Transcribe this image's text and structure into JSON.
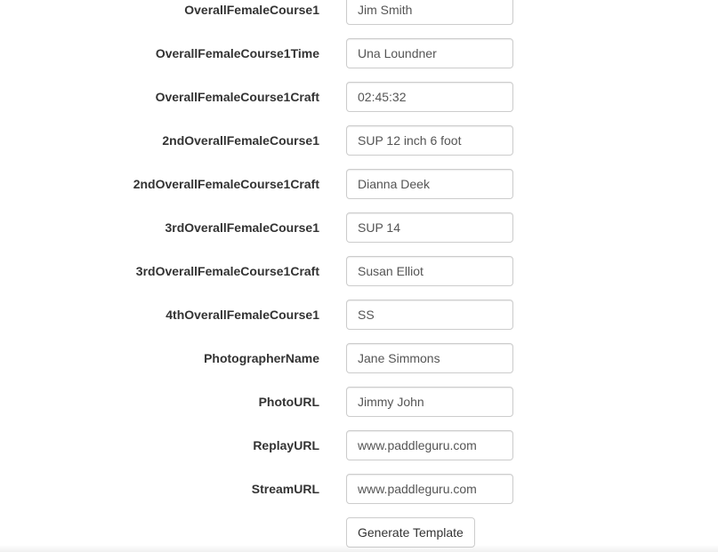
{
  "fields": [
    {
      "label": "OverallFemaleCourse1",
      "value": "Jim Smith"
    },
    {
      "label": "OverallFemaleCourse1Time",
      "value": "Una Loundner"
    },
    {
      "label": "OverallFemaleCourse1Craft",
      "value": "02:45:32"
    },
    {
      "label": "2ndOverallFemaleCourse1",
      "value": "SUP 12 inch 6 foot"
    },
    {
      "label": "2ndOverallFemaleCourse1Craft",
      "value": "Dianna Deek"
    },
    {
      "label": "3rdOverallFemaleCourse1",
      "value": "SUP 14"
    },
    {
      "label": "3rdOverallFemaleCourse1Craft",
      "value": "Susan Elliot"
    },
    {
      "label": "4thOverallFemaleCourse1",
      "value": "SS"
    },
    {
      "label": "PhotographerName",
      "value": "Jane Simmons"
    },
    {
      "label": "PhotoURL",
      "value": "Jimmy John"
    },
    {
      "label": "ReplayURL",
      "value": "www.paddleguru.com"
    },
    {
      "label": "StreamURL",
      "value": "www.paddleguru.com"
    }
  ],
  "generate_button_label": "Generate Template"
}
